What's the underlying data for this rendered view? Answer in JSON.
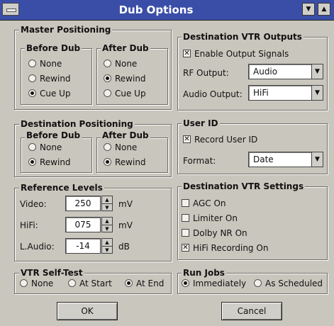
{
  "window": {
    "title": "Dub Options"
  },
  "master_positioning": {
    "label": "Master Positioning",
    "before": {
      "label": "Before Dub",
      "options": [
        "None",
        "Rewind",
        "Cue Up"
      ],
      "selected": "Cue Up"
    },
    "after": {
      "label": "After Dub",
      "options": [
        "None",
        "Rewind",
        "Cue Up"
      ],
      "selected": "Rewind"
    }
  },
  "destination_positioning": {
    "label": "Destination Positioning",
    "before": {
      "label": "Before Dub",
      "options": [
        "None",
        "Rewind"
      ],
      "selected": "Rewind"
    },
    "after": {
      "label": "After Dub",
      "options": [
        "None",
        "Rewind"
      ],
      "selected": "Rewind"
    }
  },
  "reference_levels": {
    "label": "Reference Levels",
    "rows": [
      {
        "label": "Video:",
        "value": "250",
        "unit": "mV"
      },
      {
        "label": "HiFi:",
        "value": "075",
        "unit": "mV"
      },
      {
        "label": "L.Audio:",
        "value": "-14",
        "unit": "dB"
      }
    ]
  },
  "vtr_self_test": {
    "label": "VTR Self-Test",
    "options": [
      "None",
      "At Start",
      "At End"
    ],
    "selected": "At End"
  },
  "destination_vtr_outputs": {
    "label": "Destination VTR Outputs",
    "enable_label": "Enable Output Signals",
    "enable_checked": true,
    "rf_label": "RF Output:",
    "rf_value": "Audio",
    "audio_label": "Audio Output:",
    "audio_value": "HiFi"
  },
  "user_id": {
    "label": "User ID",
    "record_label": "Record User ID",
    "record_checked": true,
    "format_label": "Format:",
    "format_value": "Date"
  },
  "destination_vtr_settings": {
    "label": "Destination VTR Settings",
    "items": [
      {
        "label": "AGC On",
        "checked": false
      },
      {
        "label": "Limiter On",
        "checked": false
      },
      {
        "label": "Dolby NR On",
        "checked": false
      },
      {
        "label": "HiFi Recording On",
        "checked": true
      }
    ]
  },
  "run_jobs": {
    "label": "Run Jobs",
    "options": [
      "Immediately",
      "As Scheduled"
    ],
    "selected": "Immediately"
  },
  "buttons": {
    "ok": "OK",
    "cancel": "Cancel"
  }
}
